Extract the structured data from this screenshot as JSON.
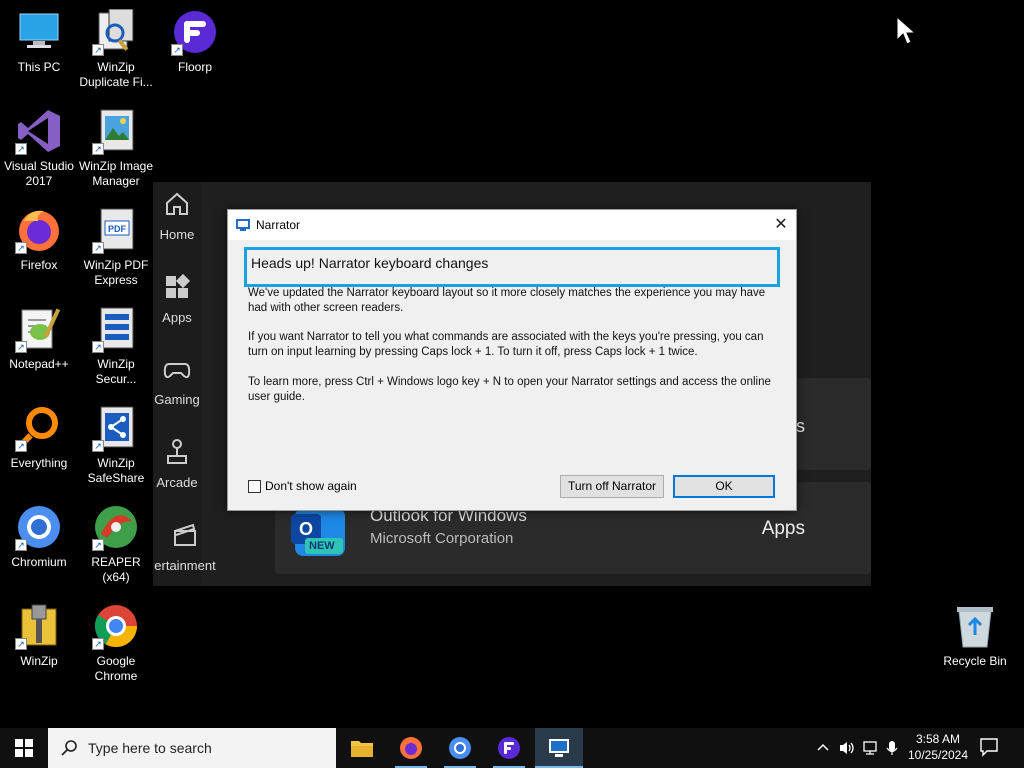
{
  "desktop": {
    "icons": [
      {
        "label": "This PC",
        "icon": "computer-icon"
      },
      {
        "label": "WinZip Duplicate Fi...",
        "icon": "winzip-duplicate-icon"
      },
      {
        "label": "Floorp",
        "icon": "floorp-icon"
      },
      {
        "label": "Visual Studio 2017",
        "icon": "visual-studio-icon"
      },
      {
        "label": "WinZip Image Manager",
        "icon": "winzip-image-icon"
      },
      {
        "label": "Firefox",
        "icon": "firefox-icon"
      },
      {
        "label": "WinZip PDF Express",
        "icon": "winzip-pdf-icon"
      },
      {
        "label": "Notepad++",
        "icon": "notepadpp-icon"
      },
      {
        "label": "WinZip Secur...",
        "icon": "winzip-secure-icon"
      },
      {
        "label": "Everything",
        "icon": "everything-icon"
      },
      {
        "label": "WinZip SafeShare",
        "icon": "winzip-safeshare-icon"
      },
      {
        "label": "Chromium",
        "icon": "chromium-icon"
      },
      {
        "label": "REAPER (x64)",
        "icon": "reaper-icon"
      },
      {
        "label": "WinZip",
        "icon": "winzip-icon"
      },
      {
        "label": "Google Chrome",
        "icon": "chrome-icon"
      },
      {
        "label": "Recycle Bin",
        "icon": "recycle-bin-icon"
      }
    ]
  },
  "store": {
    "nav": [
      {
        "label": "Home",
        "icon": "home-icon"
      },
      {
        "label": "Apps",
        "icon": "apps-icon"
      },
      {
        "label": "Gaming",
        "icon": "gamepad-icon"
      },
      {
        "label": "Arcade",
        "icon": "joystick-icon"
      },
      {
        "label": "ertainment",
        "icon": "clapperboard-icon"
      }
    ],
    "card1_suffix": "s",
    "card2": {
      "name": "Outlook for Windows",
      "publisher": "Microsoft Corporation",
      "kind": "Apps",
      "badge": "NEW"
    }
  },
  "narrator": {
    "title": "Narrator",
    "heading": "Heads up! Narrator keyboard changes",
    "paragraphs": [
      "We've updated the Narrator keyboard layout so it more closely matches the experience you may have had with other screen readers.",
      "If you want Narrator to tell you what commands are associated with the keys you're pressing, you can turn on input learning by pressing Caps lock + 1. To turn it off, press Caps lock + 1 twice.",
      "To learn more, press Ctrl + Windows logo key + N to open your Narrator settings and access the online user guide."
    ],
    "checkbox_label": "Don't show again",
    "checkbox_checked": false,
    "turn_off_label": "Turn off Narrator",
    "ok_label": "OK",
    "accent": "#1ba1e2"
  },
  "taskbar": {
    "search_placeholder": "Type here to search",
    "apps": [
      "file-explorer-icon",
      "firefox-icon",
      "chromium-icon",
      "floorp-icon",
      "narrator-icon"
    ],
    "time": "3:58 AM",
    "date": "10/25/2024"
  }
}
